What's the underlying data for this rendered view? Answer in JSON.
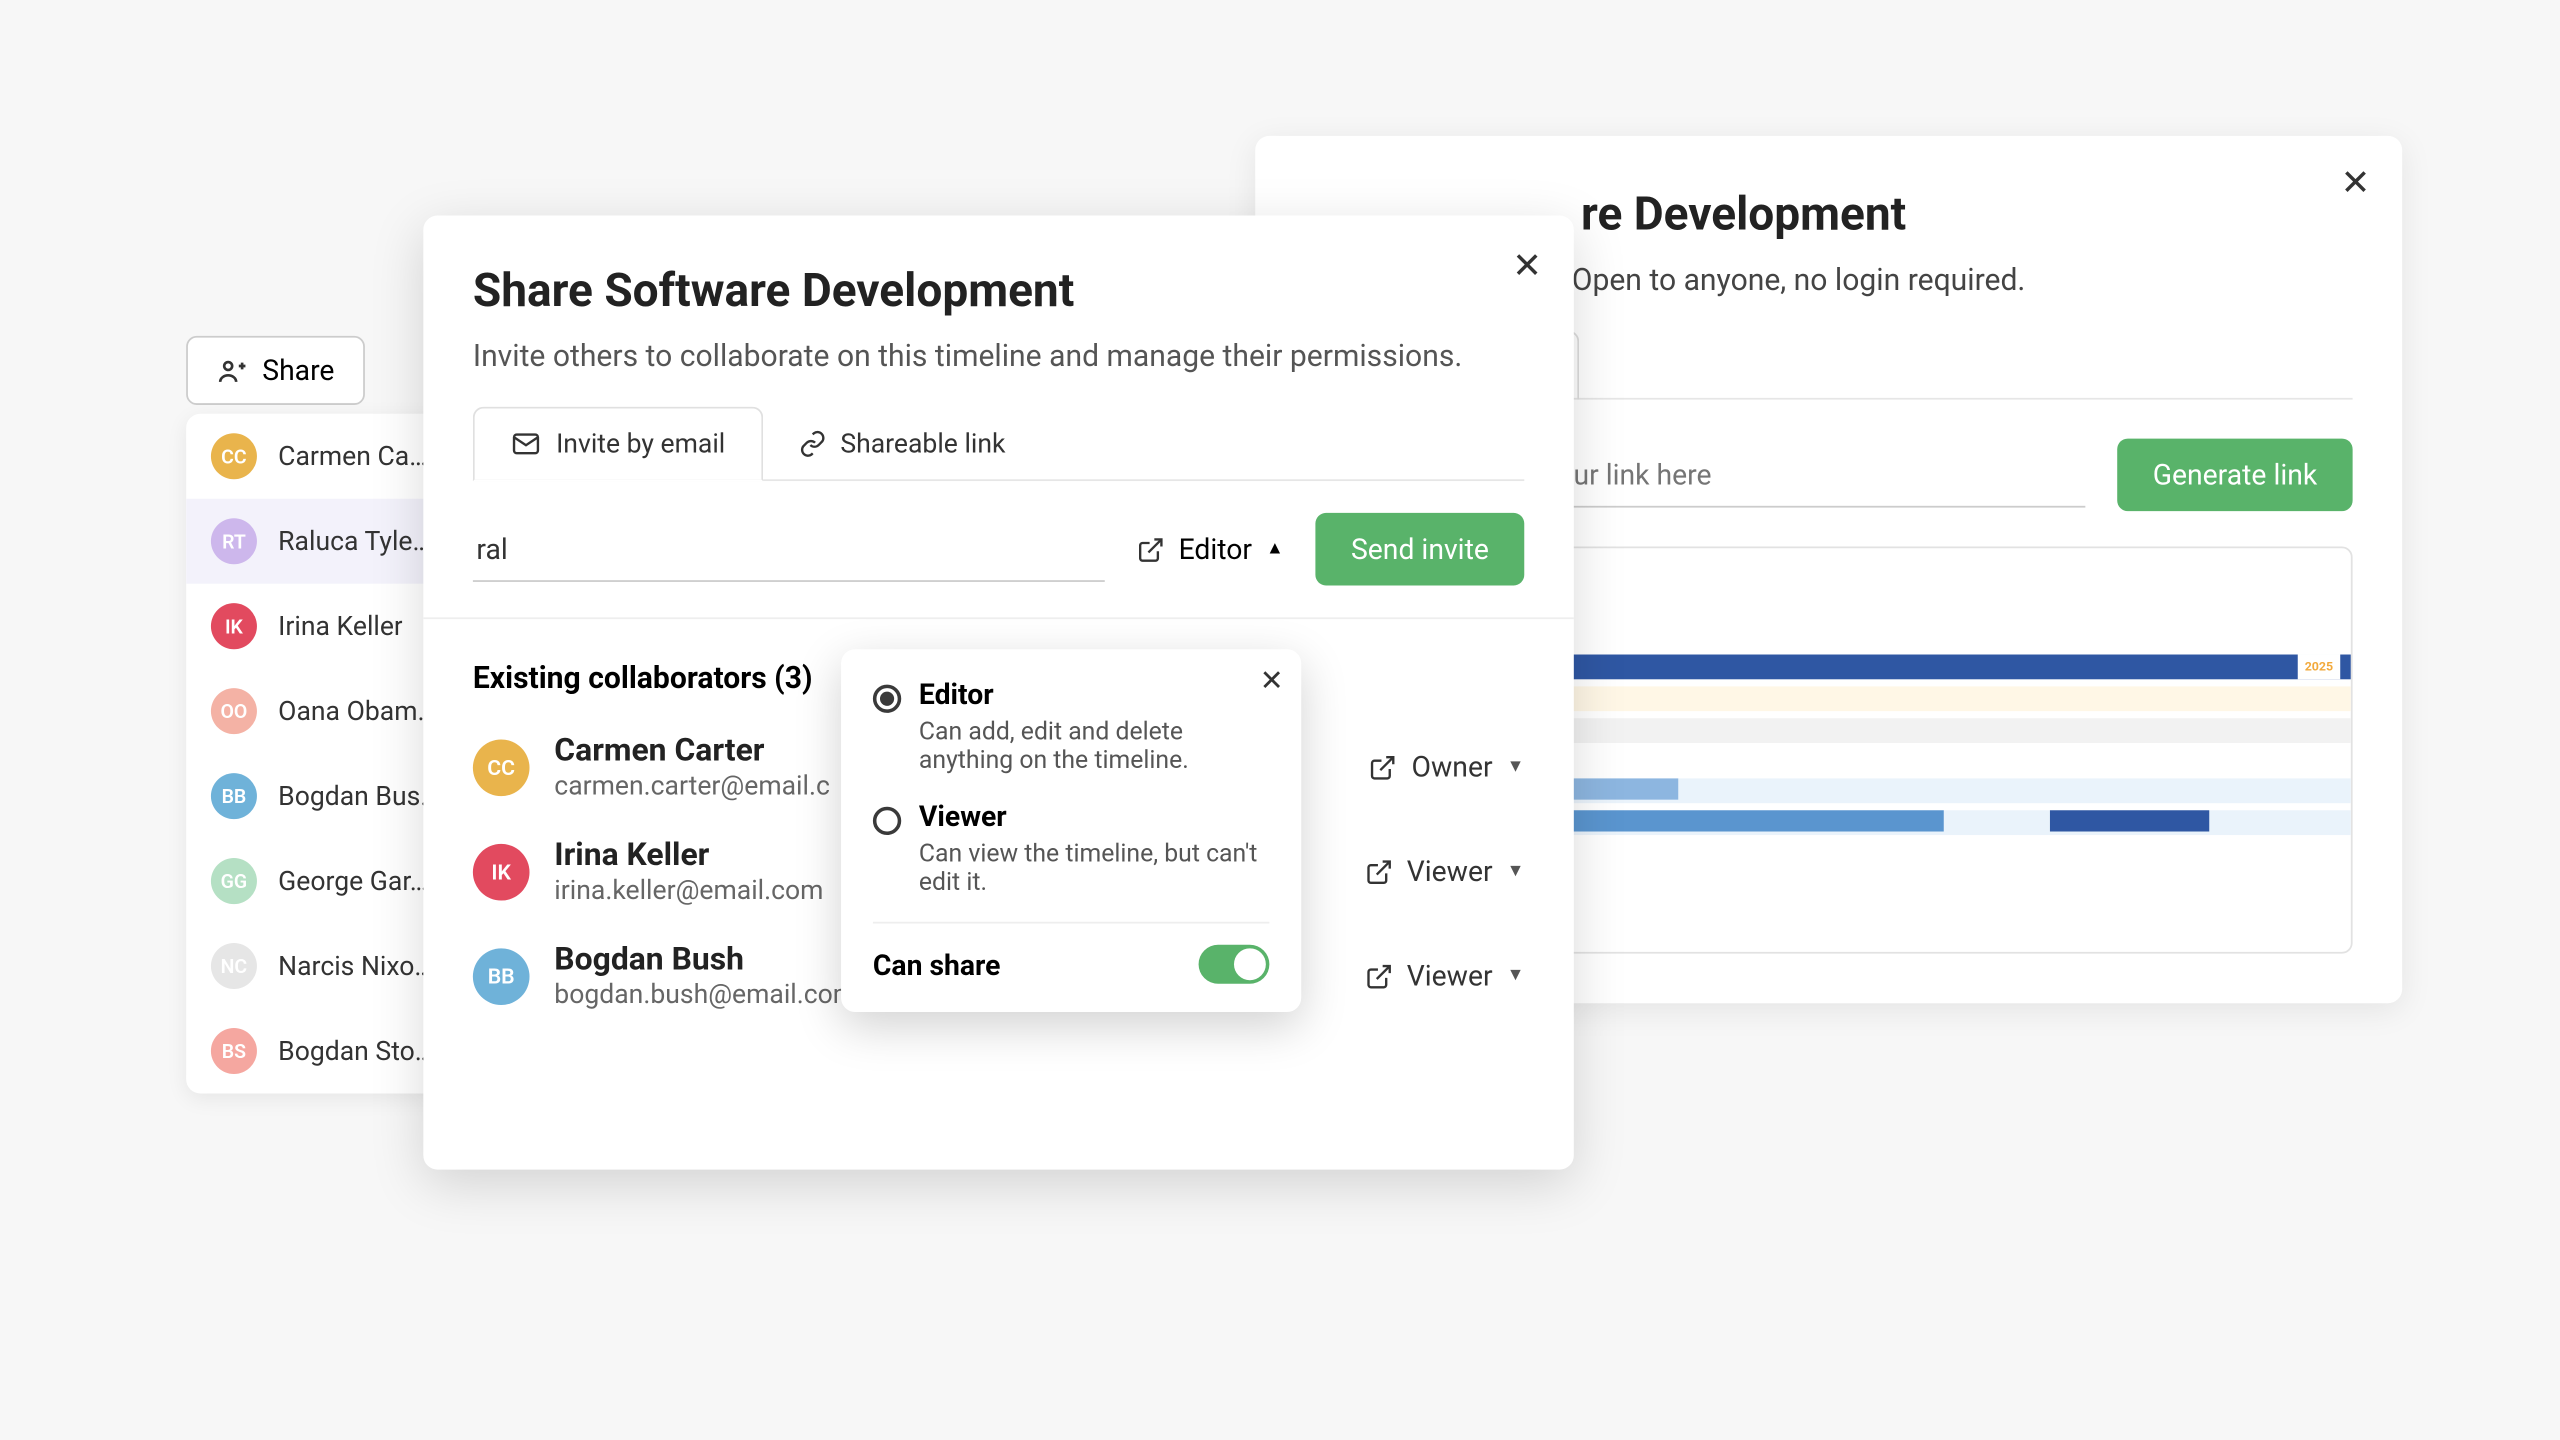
{
  "share_button": {
    "label": "Share"
  },
  "people": [
    {
      "initials": "CC",
      "name": "Carmen Ca…",
      "bg": "#e9b44c",
      "sel": false
    },
    {
      "initials": "RT",
      "name": "Raluca Tyle…",
      "bg": "#cdb7ec",
      "sel": true
    },
    {
      "initials": "IK",
      "name": "Irina Keller",
      "bg": "#e24a5f",
      "sel": false
    },
    {
      "initials": "OO",
      "name": "Oana Obam…",
      "bg": "#f4b2a5",
      "sel": false
    },
    {
      "initials": "BB",
      "name": "Bogdan Bus…",
      "bg": "#6fb2d9",
      "sel": false
    },
    {
      "initials": "GG",
      "name": "George Gar…",
      "bg": "#b5e0c4",
      "sel": false
    },
    {
      "initials": "NC",
      "name": "Narcis Nixo…",
      "bg": "#e6e6e6",
      "sel": false
    },
    {
      "initials": "BS",
      "name": "Bogdan Sto…",
      "bg": "#f5a7a0",
      "sel": false
    }
  ],
  "back": {
    "title": "Share Software Development",
    "title_visible_suffix": "re Development",
    "sub_visible": "link to this timeline. Open to anyone, no login required.",
    "tab_label": "Shareable link",
    "link_placeholder_visible": "e right to generate your link here",
    "generate_label": "Generate link",
    "year_label": "2025"
  },
  "front": {
    "title": "Share Software Development",
    "subtitle": "Invite others to collaborate on this timeline and manage their permissions.",
    "tab_invite": "Invite by email",
    "tab_link": "Shareable link",
    "input_value": "ral",
    "role_label": "Editor",
    "send_label": "Send invite",
    "existing_label": "Existing collaborators (3)",
    "collaborators": [
      {
        "initials": "CC",
        "name": "Carmen Carter",
        "email": "carmen.carter@email.c",
        "bg": "#e9b44c",
        "role": "Owner"
      },
      {
        "initials": "IK",
        "name": "Irina Keller",
        "email": "irina.keller@email.com",
        "bg": "#e24a5f",
        "role": "Viewer"
      },
      {
        "initials": "BB",
        "name": "Bogdan Bush",
        "email": "bogdan.bush@email.com",
        "bg": "#6fb2d9",
        "role": "Viewer"
      }
    ]
  },
  "popover": {
    "editor_title": "Editor",
    "editor_desc": "Can add, edit and delete anything on the timeline.",
    "viewer_title": "Viewer",
    "viewer_desc": "Can view the timeline, but can't edit it.",
    "can_share": "Can share",
    "can_share_on": true
  }
}
